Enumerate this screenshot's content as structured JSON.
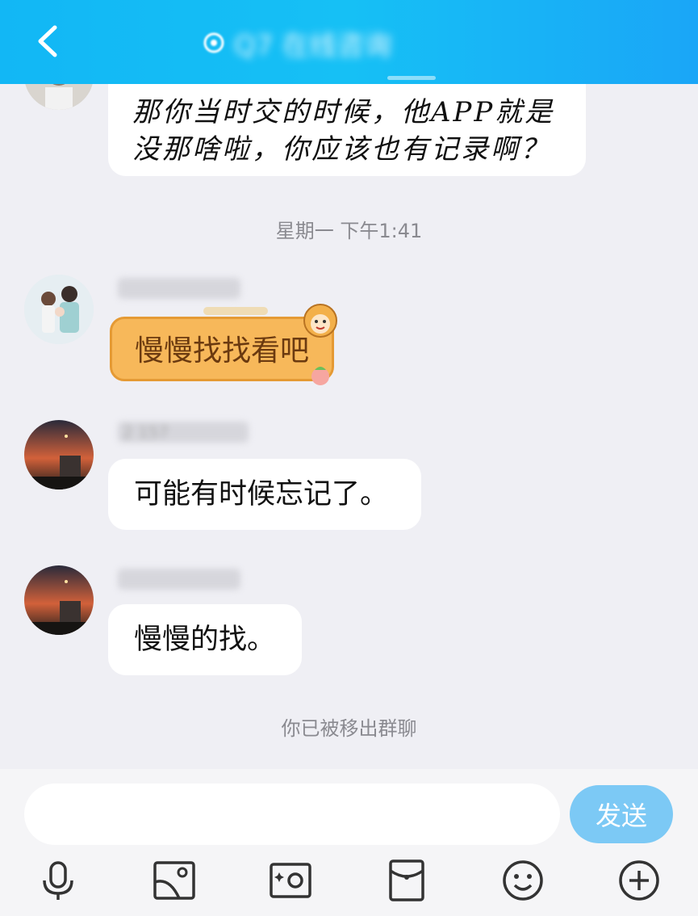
{
  "header": {
    "title": "Q7 在线咨询"
  },
  "messages": [
    {
      "text_line1": "那你当时交的时候，他APP就是",
      "text_line2": "没那啥啦，你应该也有记录啊？"
    },
    {
      "sticker_text": "慢慢找找看吧"
    },
    {
      "sender_partial": "2 157",
      "text": "可能有时候忘记了。"
    },
    {
      "text": "慢慢的找。"
    }
  ],
  "timestamp": "星期一 下午1:41",
  "system_note": "你已被移出群聊",
  "input": {
    "placeholder": "",
    "send_label": "发送"
  },
  "toolbar": [
    "mic-icon",
    "image-icon",
    "camera-icon",
    "red-packet-icon",
    "emoji-icon",
    "plus-icon"
  ],
  "colors": {
    "header": "#12b7f5",
    "send_button": "#7cc9f5",
    "background": "#efeff4",
    "sticker": "#f7b85a"
  }
}
